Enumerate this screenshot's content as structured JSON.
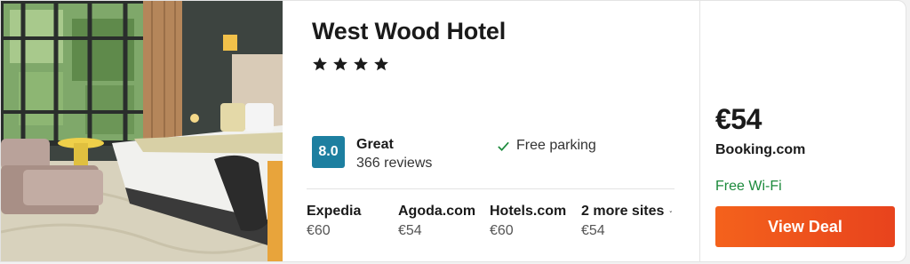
{
  "hotel": {
    "name": "West Wood Hotel",
    "star_count": 4,
    "photo_icon": "hotel-room-photo"
  },
  "rating": {
    "score": "8.0",
    "label": "Great",
    "reviews": "366 reviews",
    "badge_color": "#1d7fa0"
  },
  "amenities": [
    {
      "label": "Free parking",
      "icon": "check-icon"
    }
  ],
  "sites": [
    {
      "name": "Expedia",
      "price": "€60"
    },
    {
      "name": "Agoda.com",
      "price": "€54"
    },
    {
      "name": "Hotels.com",
      "price": "€60"
    },
    {
      "name": "2 more sites",
      "price": "€54",
      "icon": "chevron-down-icon"
    }
  ],
  "deal": {
    "price": "€54",
    "provider": "Booking.com",
    "perk": "Free Wi-Fi",
    "perk_color": "#1c8a3c",
    "button_label": "View Deal",
    "button_color": "#f05a1e"
  }
}
